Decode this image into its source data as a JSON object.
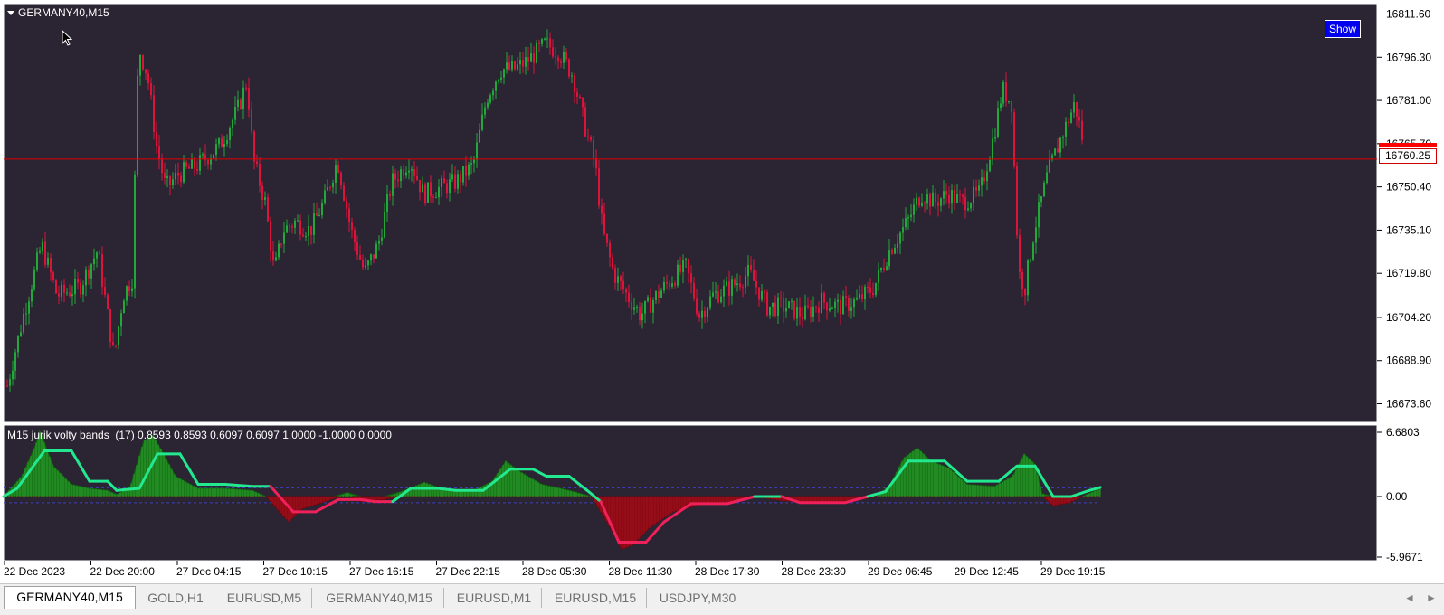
{
  "main_chart": {
    "symbol_label": "GERMANY40,M15",
    "show_button": "Show",
    "current_price": "16760.25",
    "price_ticks": [
      "16811.60",
      "16796.30",
      "16781.00",
      "16765.70",
      "16750.40",
      "16735.10",
      "16719.80",
      "16704.20",
      "16688.90",
      "16673.60"
    ],
    "time_ticks": [
      "22 Dec 2023",
      "22 Dec 20:00",
      "27 Dec 04:15",
      "27 Dec 10:15",
      "27 Dec 16:15",
      "27 Dec 22:15",
      "28 Dec 05:30",
      "28 Dec 11:30",
      "28 Dec 17:30",
      "28 Dec 23:30",
      "29 Dec 06:45",
      "29 Dec 12:45",
      "29 Dec 19:15"
    ]
  },
  "indicator": {
    "title": "M15 jurik volty bands  (17) 0.8593 0.8593 0.6097 0.6097 1.0000 -1.0000 0.0000",
    "ticks": [
      "6.6803",
      "0.00",
      "-5.9671"
    ]
  },
  "tabs": [
    {
      "label": "GERMANY40,M15",
      "active": true
    },
    {
      "label": "GOLD,H1",
      "active": false
    },
    {
      "label": "EURUSD,M5",
      "active": false
    },
    {
      "label": "GERMANY40,M15",
      "active": false
    },
    {
      "label": "EURUSD,M1",
      "active": false
    },
    {
      "label": "EURUSD,M15",
      "active": false
    },
    {
      "label": "USDJPY,M30",
      "active": false
    }
  ],
  "scroll": {
    "left": "◄",
    "right": "►"
  },
  "colors": {
    "background": "#2b2533",
    "bull": "#22a83a",
    "bear": "#dc143c",
    "price_line": "#e00000",
    "signal_line": "#22e890",
    "hist_pos": "#1a7a1a",
    "hist_neg": "#8b0a14"
  },
  "chart_data": {
    "type": "candlestick",
    "ylim": [
      16668,
      16814
    ],
    "price_line": 16760.25,
    "close_path": [
      [
        0,
        16680
      ],
      [
        18,
        16705
      ],
      [
        38,
        16730
      ],
      [
        55,
        16712
      ],
      [
        80,
        16715
      ],
      [
        100,
        16728
      ],
      [
        118,
        16690
      ],
      [
        128,
        16712
      ],
      [
        138,
        16718
      ],
      [
        145,
        16800
      ],
      [
        155,
        16790
      ],
      [
        165,
        16765
      ],
      [
        175,
        16750
      ],
      [
        190,
        16755
      ],
      [
        210,
        16758
      ],
      [
        235,
        16765
      ],
      [
        255,
        16778
      ],
      [
        265,
        16788
      ],
      [
        272,
        16760
      ],
      [
        285,
        16745
      ],
      [
        295,
        16720
      ],
      [
        305,
        16735
      ],
      [
        318,
        16738
      ],
      [
        335,
        16735
      ],
      [
        350,
        16745
      ],
      [
        365,
        16760
      ],
      [
        380,
        16735
      ],
      [
        395,
        16720
      ],
      [
        410,
        16730
      ],
      [
        425,
        16752
      ],
      [
        445,
        16760
      ],
      [
        460,
        16748
      ],
      [
        478,
        16750
      ],
      [
        495,
        16752
      ],
      [
        515,
        16758
      ],
      [
        530,
        16782
      ],
      [
        545,
        16792
      ],
      [
        560,
        16792
      ],
      [
        575,
        16795
      ],
      [
        595,
        16801
      ],
      [
        610,
        16798
      ],
      [
        625,
        16790
      ],
      [
        640,
        16770
      ],
      [
        650,
        16758
      ],
      [
        658,
        16735
      ],
      [
        670,
        16720
      ],
      [
        685,
        16712
      ],
      [
        700,
        16705
      ],
      [
        718,
        16712
      ],
      [
        735,
        16718
      ],
      [
        750,
        16722
      ],
      [
        765,
        16705
      ],
      [
        780,
        16712
      ],
      [
        800,
        16715
      ],
      [
        820,
        16720
      ],
      [
        840,
        16708
      ],
      [
        860,
        16708
      ],
      [
        880,
        16705
      ],
      [
        900,
        16710
      ],
      [
        920,
        16708
      ],
      [
        940,
        16710
      ],
      [
        958,
        16715
      ],
      [
        975,
        16728
      ],
      [
        995,
        16738
      ],
      [
        1010,
        16748
      ],
      [
        1025,
        16745
      ],
      [
        1040,
        16748
      ],
      [
        1055,
        16745
      ],
      [
        1075,
        16748
      ],
      [
        1090,
        16768
      ],
      [
        1100,
        16785
      ],
      [
        1110,
        16780
      ],
      [
        1118,
        16720
      ],
      [
        1125,
        16715
      ],
      [
        1135,
        16735
      ],
      [
        1150,
        16755
      ],
      [
        1165,
        16768
      ],
      [
        1180,
        16780
      ],
      [
        1190,
        16765
      ]
    ],
    "indicator": {
      "ylim": [
        -5.9671,
        6.6803
      ],
      "bands": [
        0.8593,
        -0.6097
      ],
      "line_path": [
        [
          0,
          0
        ],
        [
          15,
          0.8
        ],
        [
          45,
          4.5
        ],
        [
          75,
          4.5
        ],
        [
          95,
          1.5
        ],
        [
          115,
          1.5
        ],
        [
          125,
          0.6
        ],
        [
          150,
          0.8
        ],
        [
          170,
          4.2
        ],
        [
          195,
          4.2
        ],
        [
          215,
          1.2
        ],
        [
          245,
          1.2
        ],
        [
          275,
          1.0
        ],
        [
          295,
          1.0
        ],
        [
          320,
          -1.5
        ],
        [
          345,
          -1.5
        ],
        [
          370,
          -0.3
        ],
        [
          395,
          -0.3
        ],
        [
          410,
          -0.5
        ],
        [
          430,
          -0.5
        ],
        [
          450,
          0.8
        ],
        [
          480,
          0.8
        ],
        [
          500,
          0.6
        ],
        [
          530,
          0.6
        ],
        [
          560,
          2.7
        ],
        [
          585,
          2.7
        ],
        [
          600,
          2.0
        ],
        [
          625,
          2.0
        ],
        [
          645,
          0.6
        ],
        [
          660,
          -0.5
        ],
        [
          680,
          -4.5
        ],
        [
          710,
          -4.5
        ],
        [
          730,
          -2.5
        ],
        [
          760,
          -0.7
        ],
        [
          800,
          -0.7
        ],
        [
          830,
          0.0
        ],
        [
          860,
          0.0
        ],
        [
          880,
          -0.6
        ],
        [
          930,
          -0.6
        ],
        [
          955,
          0.0
        ],
        [
          975,
          0.5
        ],
        [
          1000,
          3.5
        ],
        [
          1040,
          3.5
        ],
        [
          1065,
          1.5
        ],
        [
          1100,
          1.5
        ],
        [
          1120,
          3.0
        ],
        [
          1140,
          3.0
        ],
        [
          1160,
          0.0
        ],
        [
          1180,
          0.0
        ],
        [
          1200,
          0.6
        ],
        [
          1212,
          0.9
        ]
      ],
      "hist_path": [
        [
          0,
          0
        ],
        [
          20,
          2
        ],
        [
          35,
          5
        ],
        [
          40,
          6.5
        ],
        [
          55,
          3
        ],
        [
          75,
          1.2
        ],
        [
          95,
          0.8
        ],
        [
          115,
          0.6
        ],
        [
          125,
          0.2
        ],
        [
          140,
          1.0
        ],
        [
          155,
          5.5
        ],
        [
          165,
          6.0
        ],
        [
          175,
          4.5
        ],
        [
          190,
          2
        ],
        [
          215,
          0.8
        ],
        [
          245,
          0.8
        ],
        [
          275,
          0.6
        ],
        [
          290,
          0
        ],
        [
          305,
          -1.5
        ],
        [
          315,
          -2.5
        ],
        [
          330,
          -1.2
        ],
        [
          345,
          -0.8
        ],
        [
          365,
          -0.2
        ],
        [
          380,
          0.4
        ],
        [
          395,
          -0.5
        ],
        [
          420,
          -0.3
        ],
        [
          440,
          0.5
        ],
        [
          465,
          1.4
        ],
        [
          490,
          0.6
        ],
        [
          520,
          0.6
        ],
        [
          540,
          1.5
        ],
        [
          555,
          3.5
        ],
        [
          570,
          2.5
        ],
        [
          595,
          1.2
        ],
        [
          625,
          0.6
        ],
        [
          650,
          0
        ],
        [
          670,
          -3
        ],
        [
          683,
          -5.2
        ],
        [
          695,
          -4.8
        ],
        [
          715,
          -3.0
        ],
        [
          740,
          -1.5
        ],
        [
          770,
          -0.8
        ],
        [
          800,
          -0.6
        ],
        [
          830,
          0.0
        ],
        [
          860,
          -0.4
        ],
        [
          890,
          -0.6
        ],
        [
          920,
          -0.5
        ],
        [
          945,
          -0.3
        ],
        [
          965,
          0
        ],
        [
          980,
          1.2
        ],
        [
          995,
          3.8
        ],
        [
          1010,
          4.8
        ],
        [
          1025,
          3.5
        ],
        [
          1045,
          2.8
        ],
        [
          1065,
          1.2
        ],
        [
          1095,
          1.0
        ],
        [
          1115,
          2.0
        ],
        [
          1128,
          4.2
        ],
        [
          1140,
          3.2
        ],
        [
          1148,
          0.3
        ],
        [
          1160,
          -0.9
        ],
        [
          1178,
          -0.6
        ],
        [
          1192,
          0.0
        ],
        [
          1212,
          0.8
        ]
      ]
    }
  }
}
